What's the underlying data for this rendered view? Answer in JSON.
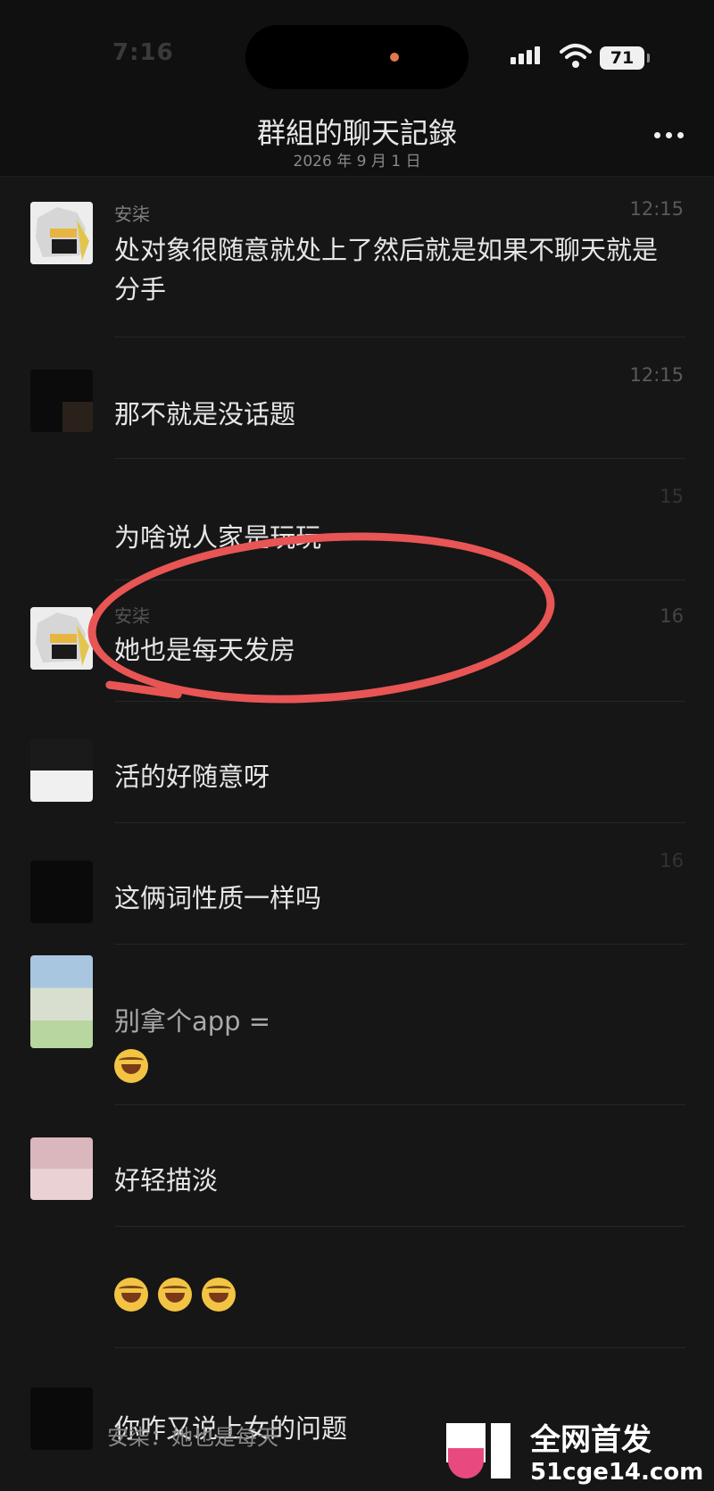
{
  "status": {
    "time": "7:16",
    "battery": "71"
  },
  "nav": {
    "title": "群組的聊天記錄",
    "subtitle": "2026 年 9 月 1 日"
  },
  "messages": [
    {
      "sender": "安柒",
      "time": "12:15",
      "text": "处对象很随意就处上了然后就是如果不聊天就是分手"
    },
    {
      "sender": "",
      "time": "12:15",
      "text": "那不就是没话题"
    },
    {
      "sender": "",
      "time": "15",
      "text": "为啥说人家是玩玩"
    },
    {
      "sender": "安柒",
      "time": "16",
      "text": "她也是每天发房"
    },
    {
      "sender": "",
      "time": "",
      "text": "活的好随意呀"
    },
    {
      "sender": "",
      "time": "16",
      "text": "这俩词性质一样吗"
    },
    {
      "sender": "",
      "time": "",
      "text": "别拿个app ="
    },
    {
      "sender": "",
      "time": "",
      "text": "好轻描淡"
    },
    {
      "sender": "",
      "time": "",
      "text": ""
    },
    {
      "sender": "",
      "time": "",
      "text": "你咋又说上女的问题"
    }
  ],
  "quote": "安柒：她也是每天",
  "watermark": {
    "title": "全网首发",
    "url": "51cge14.com"
  }
}
